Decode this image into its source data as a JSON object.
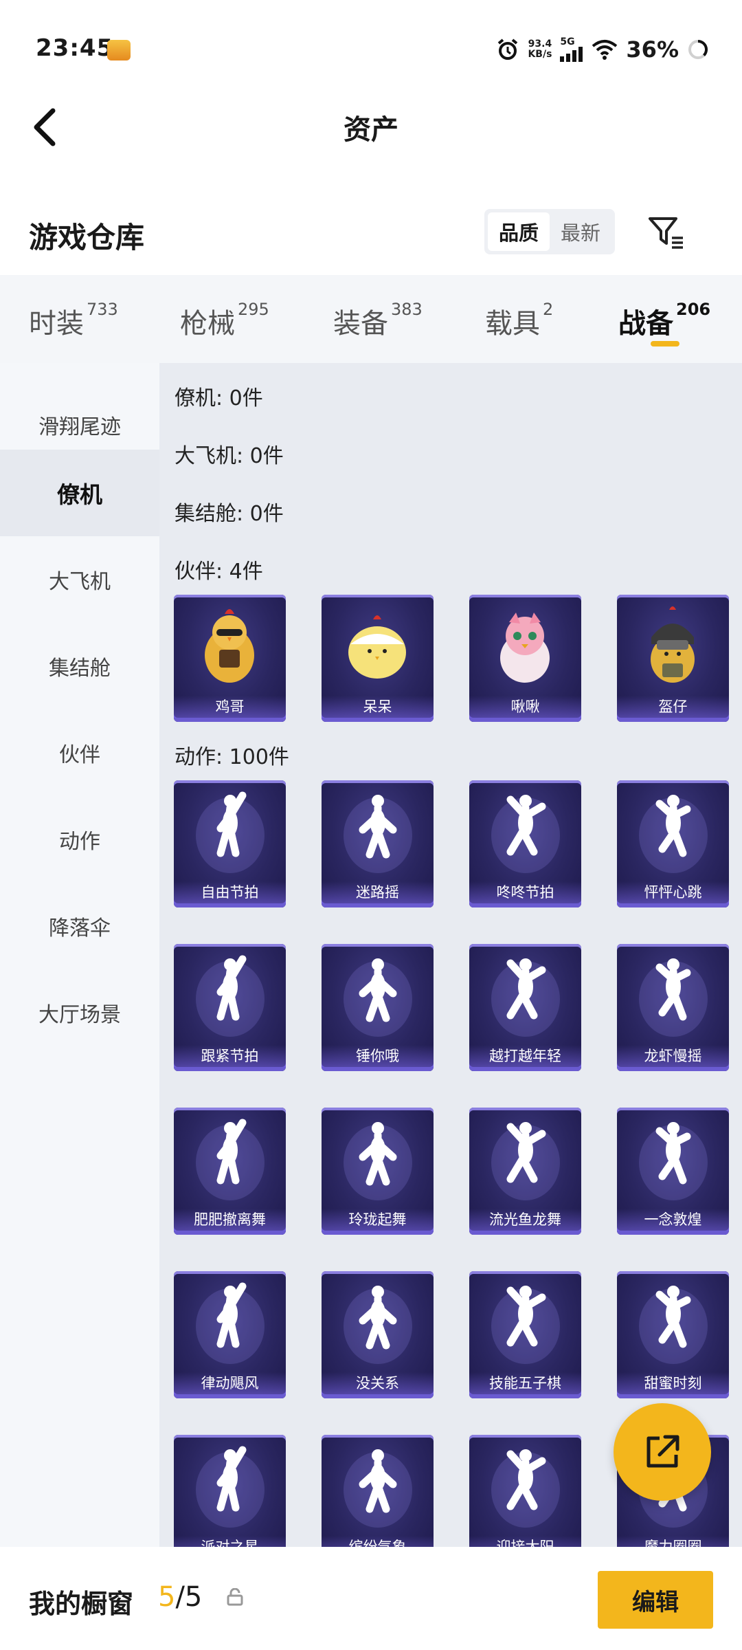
{
  "status_bar": {
    "time": "23:45",
    "net_speed_value": "93.4",
    "net_speed_unit": "KB/s",
    "network_type": "5G",
    "battery": "36%"
  },
  "header": {
    "title": "资产"
  },
  "warehouse": {
    "title": "游戏仓库",
    "sort_quality": "品质",
    "sort_newest": "最新"
  },
  "category_tabs": [
    {
      "label": "时装",
      "count": "733"
    },
    {
      "label": "枪械",
      "count": "295"
    },
    {
      "label": "装备",
      "count": "383"
    },
    {
      "label": "载具",
      "count": "2"
    },
    {
      "label": "战备",
      "count": "206"
    }
  ],
  "side_nav": [
    {
      "label": "滑翔尾迹"
    },
    {
      "label": "僚机"
    },
    {
      "label": "大飞机"
    },
    {
      "label": "集结舱"
    },
    {
      "label": "伙伴"
    },
    {
      "label": "动作"
    },
    {
      "label": "降落伞"
    },
    {
      "label": "大厅场景"
    }
  ],
  "sections": {
    "wingman": "僚机: 0件",
    "big_plane": "大飞机: 0件",
    "rally_pod": "集结舱: 0件",
    "partner": "伙伴: 4件",
    "emote": "动作: 100件"
  },
  "partners": [
    {
      "name": "鸡哥"
    },
    {
      "name": "呆呆"
    },
    {
      "name": "啾啾"
    },
    {
      "name": "盔仔"
    }
  ],
  "emotes": [
    {
      "name": "自由节拍"
    },
    {
      "name": "迷路摇"
    },
    {
      "name": "咚咚节拍"
    },
    {
      "name": "怦怦心跳"
    },
    {
      "name": "跟紧节拍"
    },
    {
      "name": "锤你哦"
    },
    {
      "name": "越打越年轻"
    },
    {
      "name": "龙虾慢摇"
    },
    {
      "name": "肥肥撤离舞"
    },
    {
      "name": "玲珑起舞"
    },
    {
      "name": "流光鱼龙舞"
    },
    {
      "name": "一念敦煌"
    },
    {
      "name": "律动飓风"
    },
    {
      "name": "没关系"
    },
    {
      "name": "技能五子棋"
    },
    {
      "name": "甜蜜时刻"
    },
    {
      "name": "派对之星"
    },
    {
      "name": "缤纷气象"
    },
    {
      "name": "迎接太阳"
    },
    {
      "name": "魔力圈圈"
    }
  ],
  "bottom_bar": {
    "label": "我的橱窗",
    "current": "5",
    "total": "/5",
    "edit_label": "编辑"
  },
  "colors": {
    "accent": "#f3b61c",
    "card_bg": "#2a2660",
    "content_bg": "#e8ebf1"
  }
}
